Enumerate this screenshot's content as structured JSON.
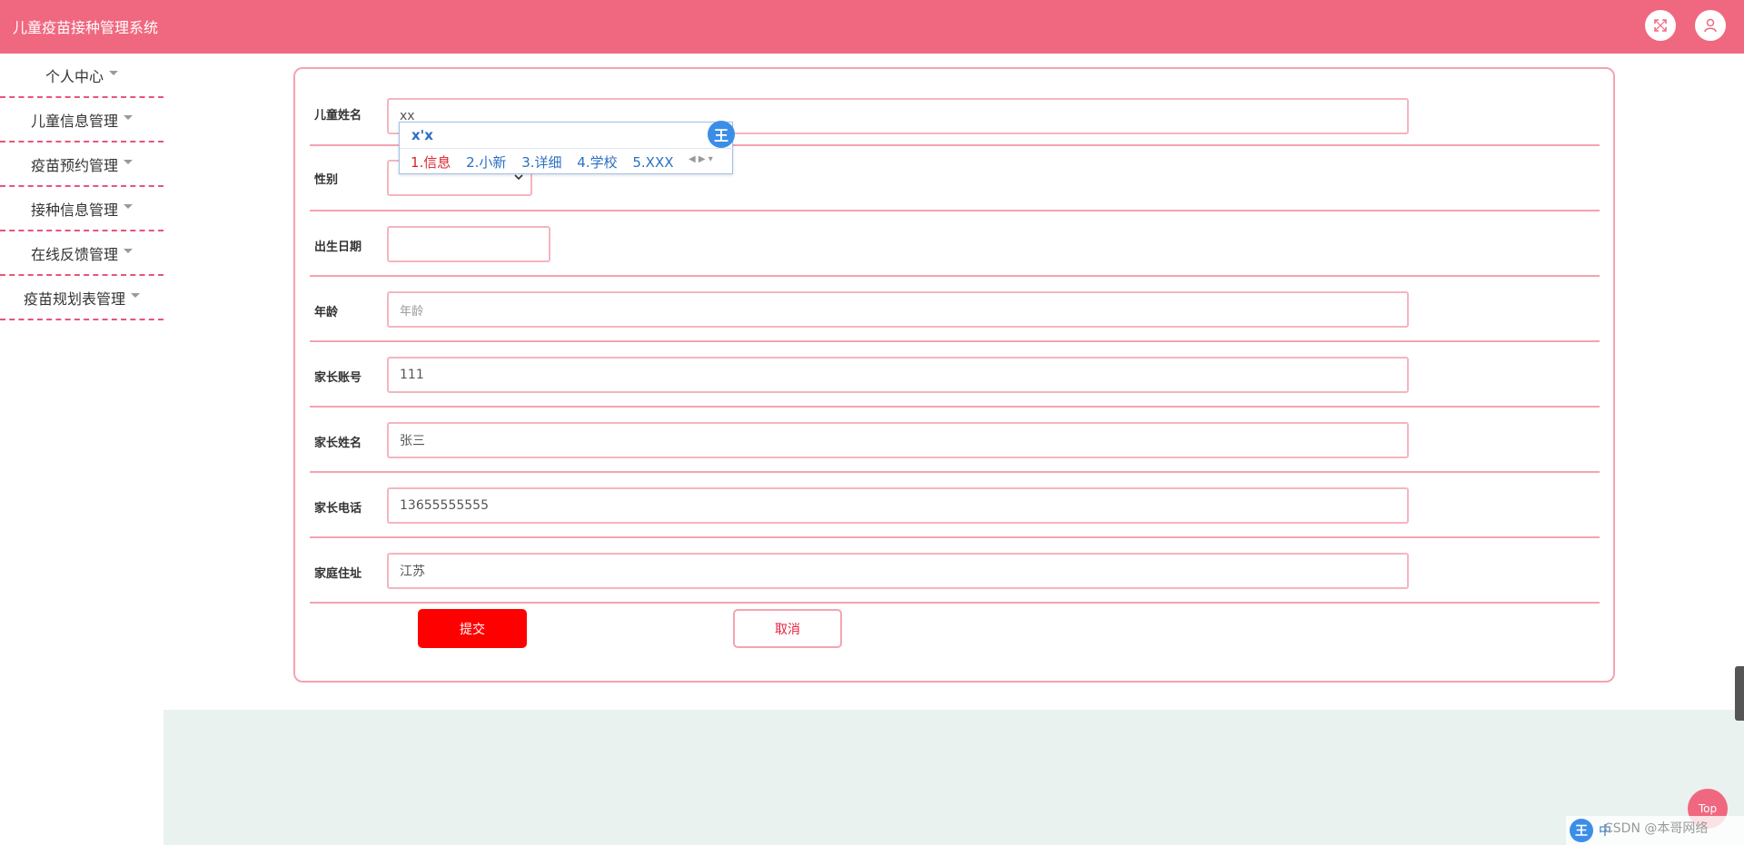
{
  "app": {
    "title": "儿童疫苗接种管理系统"
  },
  "header": {
    "icons": [
      "fullscreen-icon",
      "user-icon"
    ]
  },
  "sidebar": {
    "items": [
      {
        "label": "个人中心"
      },
      {
        "label": "儿童信息管理"
      },
      {
        "label": "疫苗预约管理"
      },
      {
        "label": "接种信息管理"
      },
      {
        "label": "在线反馈管理"
      },
      {
        "label": "疫苗规划表管理"
      }
    ]
  },
  "form": {
    "child_name": {
      "label": "儿童姓名",
      "value": "xx"
    },
    "gender": {
      "label": "性别",
      "value": ""
    },
    "birth_date": {
      "label": "出生日期",
      "value": ""
    },
    "age": {
      "label": "年龄",
      "placeholder": "年龄"
    },
    "parent_account": {
      "label": "家长账号",
      "value": "111"
    },
    "parent_name": {
      "label": "家长姓名",
      "value": "张三"
    },
    "parent_phone": {
      "label": "家长电话",
      "value": "13655555555"
    },
    "home_address": {
      "label": "家庭住址",
      "value": "江苏"
    },
    "submit_label": "提交",
    "cancel_label": "取消"
  },
  "ime": {
    "composition": "x'x",
    "candidates": [
      "1.信息",
      "2.小新",
      "3.详细",
      "4.学校",
      "5.XXX"
    ],
    "logo": "王"
  },
  "floating": {
    "top_label": "Top",
    "watermark": "CSDN @本哥网络",
    "tray_text": "中"
  },
  "colors": {
    "brand": "#f0687f",
    "border": "#f5a3b1",
    "submit": "#ff0000",
    "band": "#e9f2ee"
  }
}
